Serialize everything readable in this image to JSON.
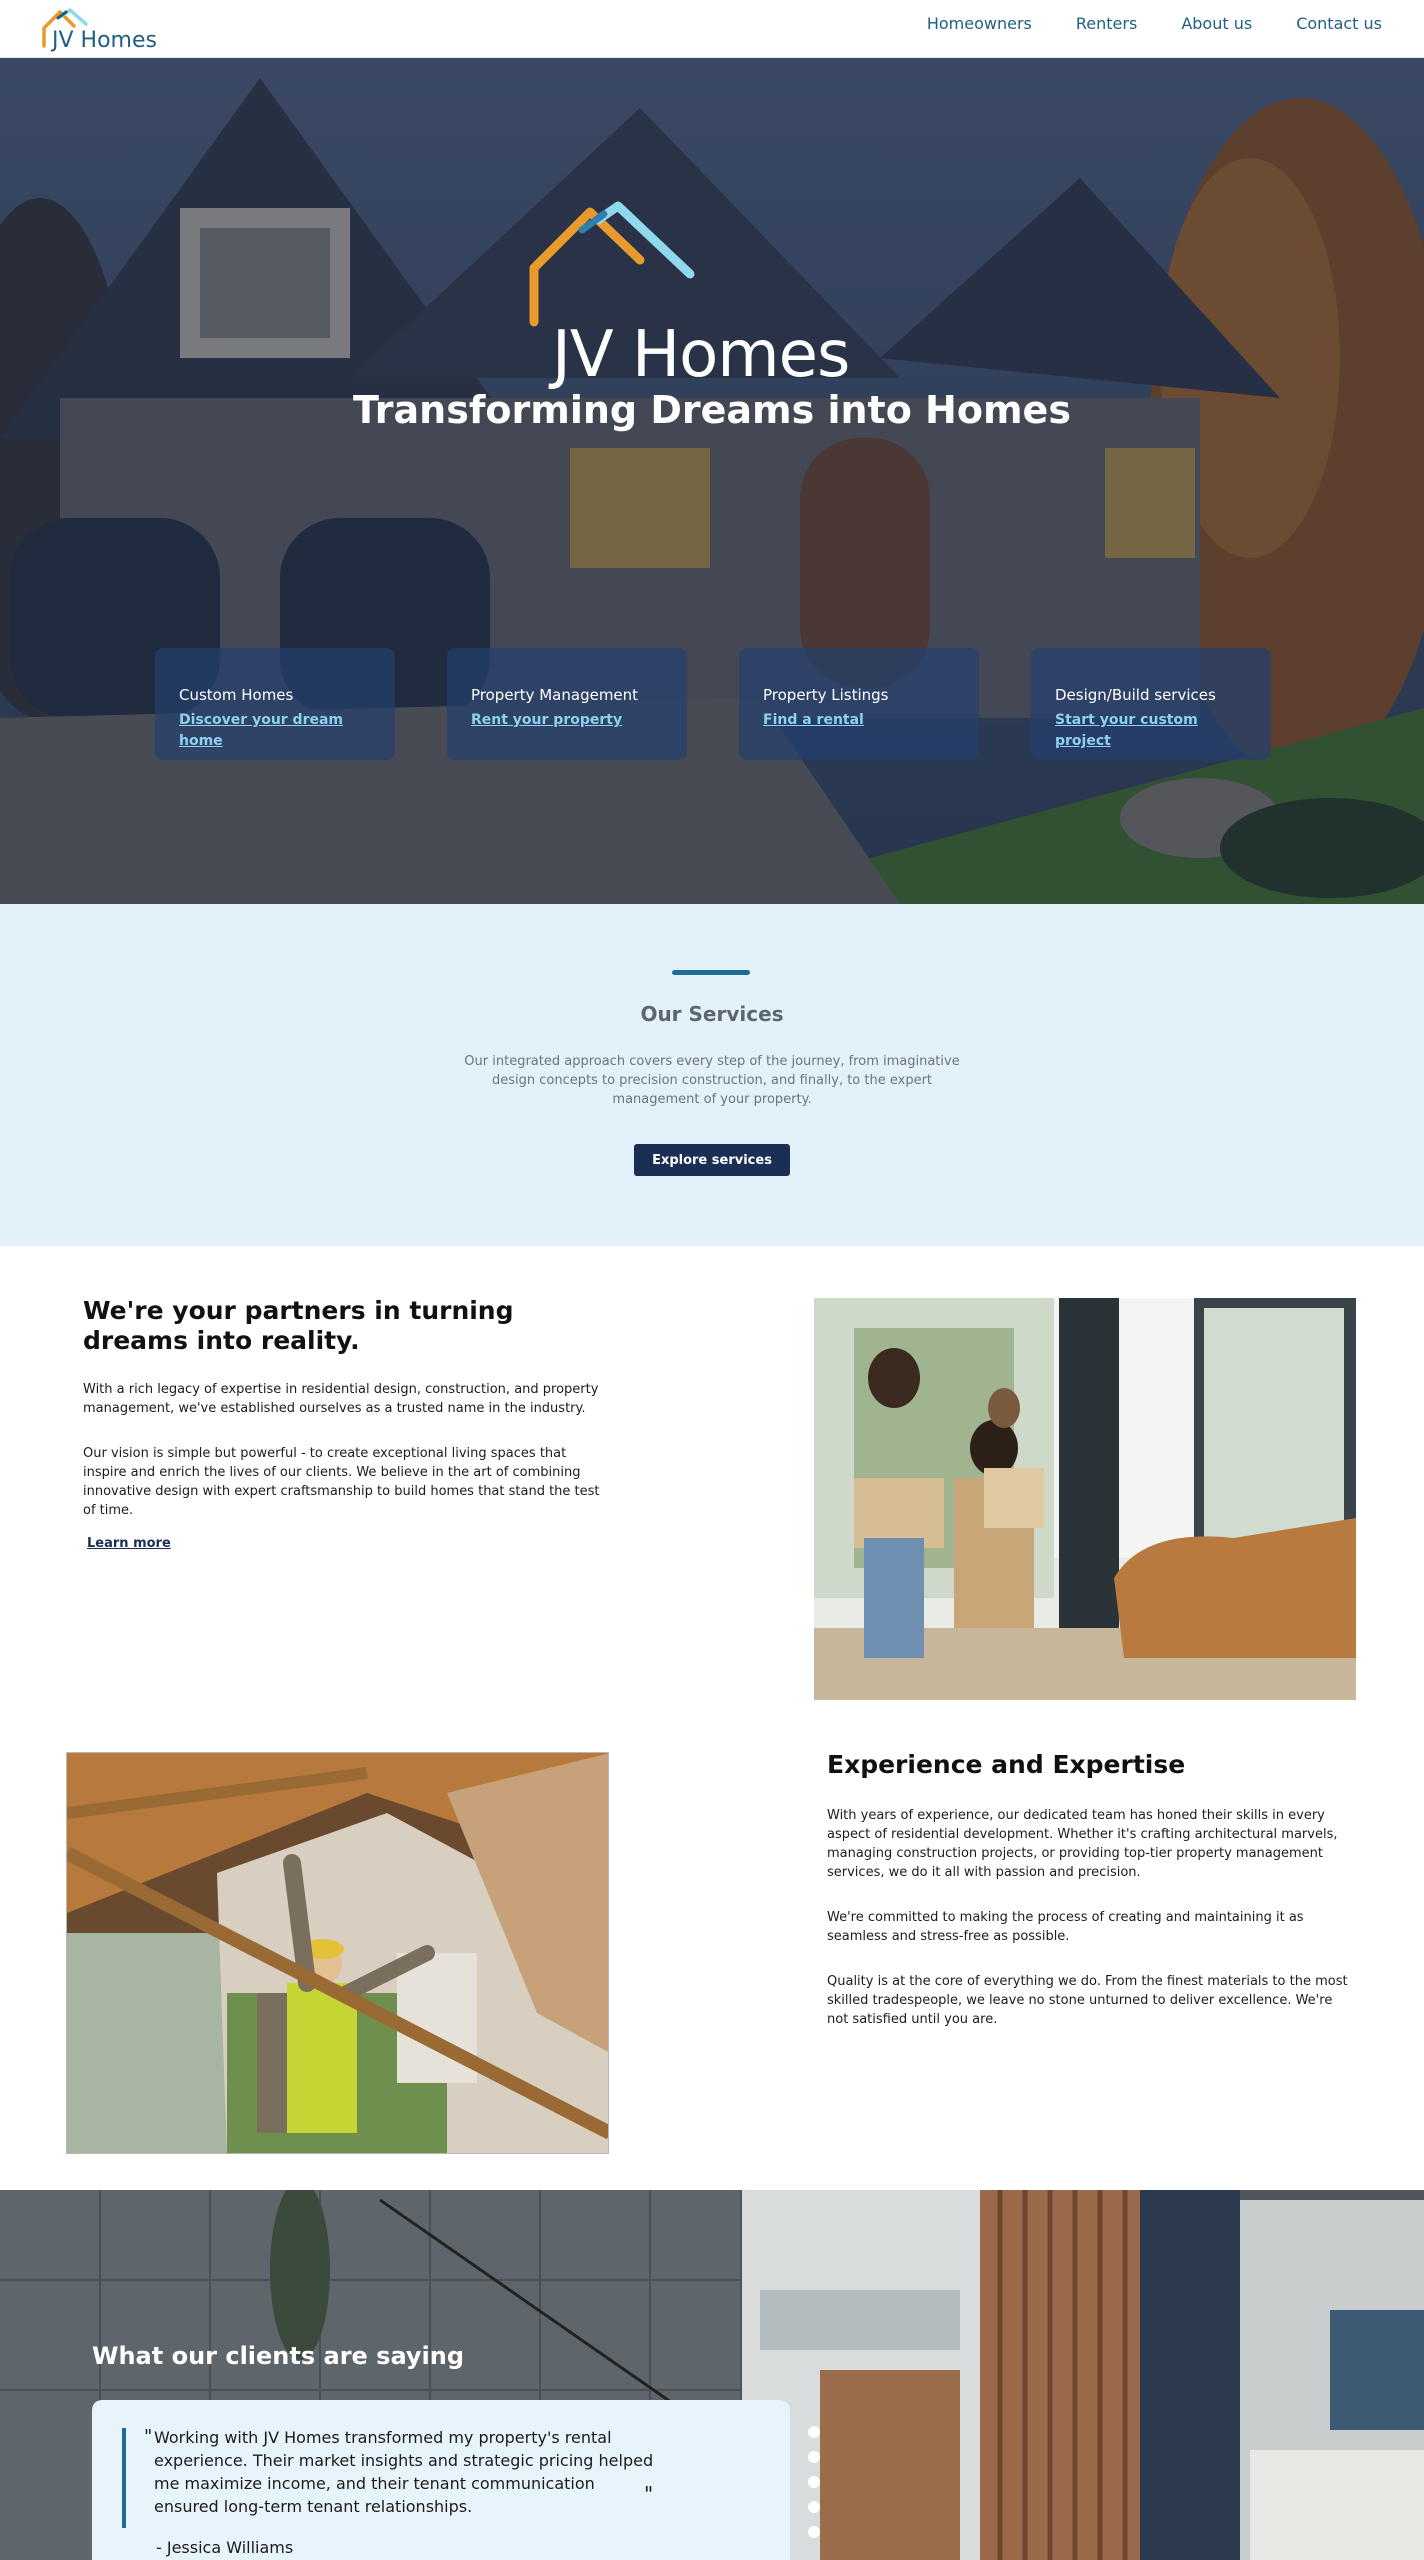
{
  "nav": {
    "logo_text": "JV Homes",
    "links": [
      "Homeowners",
      "Renters",
      "About us",
      "Contact us"
    ]
  },
  "hero": {
    "logo_text": "JV Homes",
    "title": "Transforming Dreams into Homes",
    "cards": [
      {
        "title": "Custom Homes",
        "link": "Discover your dream home"
      },
      {
        "title": "Property Management",
        "link": "Rent your property"
      },
      {
        "title": "Property Listings",
        "link": "Find a rental"
      },
      {
        "title": "Design/Build services",
        "link": "Start your custom project"
      }
    ]
  },
  "services": {
    "title": "Our Services",
    "text": "Our integrated approach covers every step of the journey, from imaginative design concepts to precision construction, and finally, to the expert management of your property.",
    "button": "Explore services"
  },
  "partners": {
    "title": "We're your partners in turning dreams into reality.",
    "p1": "With a rich legacy of expertise in residential design, construction, and property management, we've established ourselves as a trusted name in the industry.",
    "p2": "Our vision is simple but powerful - to create exceptional living spaces that inspire and enrich the lives of our clients. We believe in the art of combining innovative design with expert craftsmanship to build homes that stand the test of time.",
    "link": "Learn more"
  },
  "experience": {
    "title": "Experience and Expertise",
    "p1": "With years of experience, our dedicated team has honed their skills in every aspect of residential development. Whether it's crafting architectural marvels, managing construction projects, or providing top-tier property management services, we do it all with passion and precision.",
    "p2": "We're committed to making the process of creating and maintaining it as seamless and stress-free as possible.",
    "p3": "Quality is at the core of everything we do. From the finest materials to the most skilled tradespeople, we leave no stone unturned to deliver excellence. We're not satisfied until you are."
  },
  "testimonials": {
    "title": "What our clients are saying",
    "quote": "Working with JV Homes transformed my property's rental experience. Their market insights and strategic pricing helped me maximize income, and their tenant communication ensured long-term tenant relationships.",
    "quote_open": "\"",
    "quote_close": "\"",
    "author": "- Jessica Williams",
    "dot_count": 5
  },
  "colors": {
    "brand_blue": "#1f5f86",
    "logo_orange": "#e89a2c",
    "logo_light_blue": "#8fd8ee",
    "dark_navy": "#1b2f55",
    "services_bg": "#e3f1fa"
  }
}
